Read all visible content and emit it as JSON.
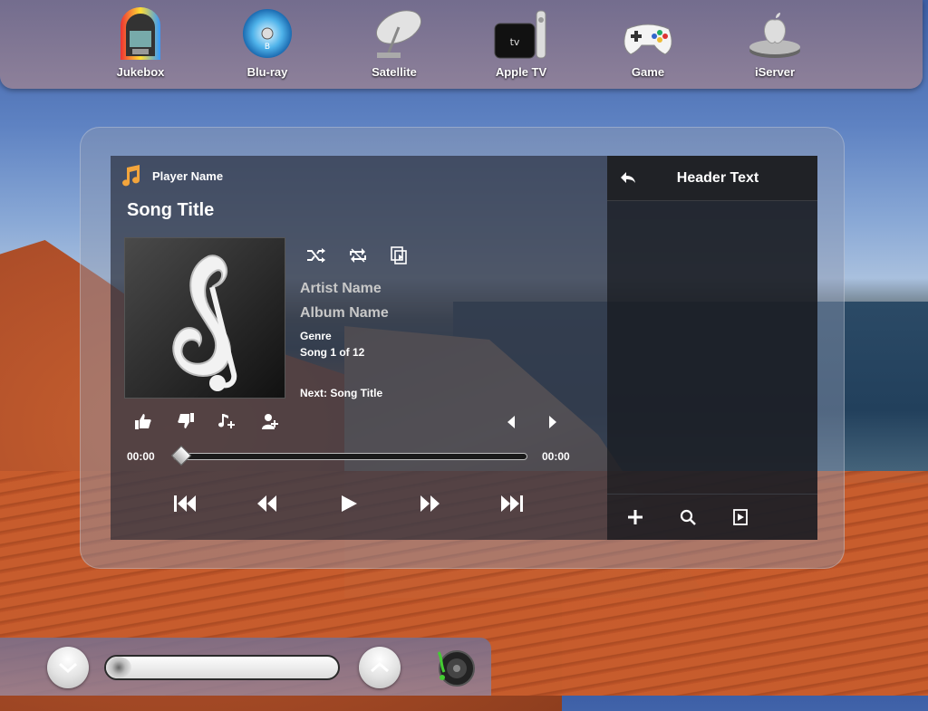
{
  "dock": {
    "items": [
      {
        "label": "Jukebox",
        "icon": "jukebox-icon"
      },
      {
        "label": "Blu-ray",
        "icon": "bluray-disc-icon"
      },
      {
        "label": "Satellite",
        "icon": "satellite-dish-icon"
      },
      {
        "label": "Apple TV",
        "icon": "apple-tv-icon"
      },
      {
        "label": "Game",
        "icon": "gamepad-icon"
      },
      {
        "label": "iServer",
        "icon": "iserver-icon"
      }
    ]
  },
  "player": {
    "player_name": "Player Name",
    "song_title": "Song Title",
    "artist": "Artist Name",
    "album": "Album Name",
    "genre": "Genre",
    "track_count": "Song 1 of 12",
    "next": "Next: Song Title",
    "time_elapsed": "00:00",
    "time_total": "00:00",
    "progress": 0
  },
  "sidebar": {
    "header": "Header Text"
  },
  "volume": {
    "level": 0
  },
  "colors": {
    "panel": "#1e222d",
    "sidebar": "#16181e",
    "accent": "#f3a53c"
  }
}
